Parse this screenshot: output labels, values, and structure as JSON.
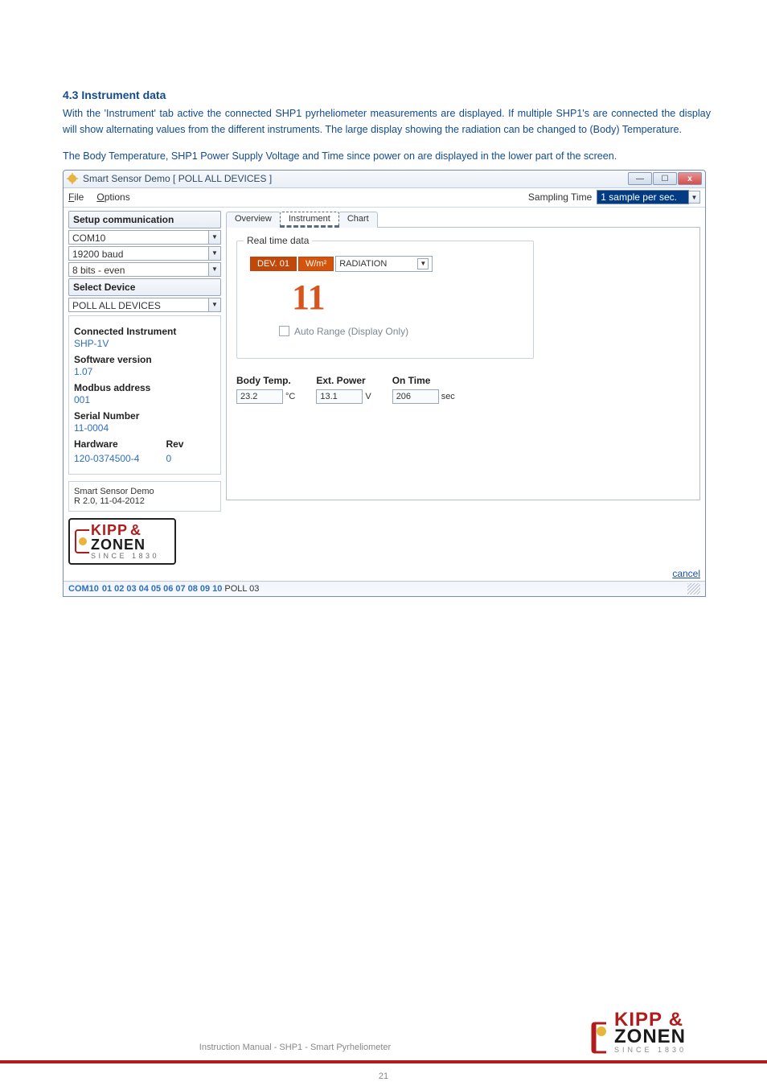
{
  "section": {
    "heading": "4.3 Instrument data",
    "p1": "With the 'Instrument' tab active the connected SHP1 pyrheliometer measurements are displayed. If multiple SHP1's are connected the display will show alternating values from the different instruments. The large display showing the radiation can be changed to (Body) Temperature.",
    "p2": "The Body Temperature, SHP1 Power Supply Voltage and Time since power on are displayed in the lower part of the screen."
  },
  "window": {
    "title": "Smart Sensor Demo [ POLL ALL DEVICES ]",
    "menu": {
      "file": "File",
      "options": "Options"
    },
    "sampling_label": "Sampling Time",
    "sampling_value": "1 sample per sec."
  },
  "left": {
    "setup": "Setup communication",
    "com_port": "COM10",
    "baud": "19200 baud",
    "bits": "8 bits - even",
    "select": "Select Device",
    "poll": "POLL ALL DEVICES",
    "info": {
      "connected_label": "Connected Instrument",
      "connected_value": "SHP-1V",
      "software_label": "Software version",
      "software_value": "1.07",
      "modbus_label": "Modbus address",
      "modbus_value": "001",
      "serial_label": "Serial Number",
      "serial_value": "11-0004",
      "hardware_label": "Hardware",
      "rev_label": "Rev",
      "hardware_value": "120-0374500-4",
      "rev_value": "0"
    },
    "version": {
      "name": "Smart Sensor Demo",
      "rev": "R 2.0, 11-04-2012"
    },
    "logo": {
      "brand1": "KIPP",
      "amp": "&",
      "brand2": "ZONEN",
      "since": "SINCE 1830"
    }
  },
  "tabs": {
    "overview": "Overview",
    "instrument": "Instrument",
    "chart": "Chart"
  },
  "realtime": {
    "group": "Real time data",
    "dev": "DEV. 01",
    "unit": "W/m²",
    "measure": "RADIATION",
    "value": "11",
    "auto_range": "Auto Range (Display Only)"
  },
  "metrics": {
    "body_temp_label": "Body Temp.",
    "body_temp_value": "23.2",
    "body_temp_unit": "°C",
    "ext_power_label": "Ext. Power",
    "ext_power_value": "13.1",
    "ext_power_unit": "V",
    "on_time_label": "On Time",
    "on_time_value": "206",
    "on_time_unit": "sec"
  },
  "cancel": "cancel",
  "status": {
    "com": "COM10",
    "addrs": [
      "01",
      "02",
      "03",
      "04",
      "05",
      "06",
      "07",
      "08",
      "09",
      "10"
    ],
    "poll": "POLL 03"
  },
  "footer": {
    "manual": "Instruction Manual - SHP1 - Smart Pyrheliometer",
    "page": "21",
    "brand1": "KIPP",
    "amp": "&",
    "brand2": "ZONEN",
    "since": "SINCE 1830"
  }
}
